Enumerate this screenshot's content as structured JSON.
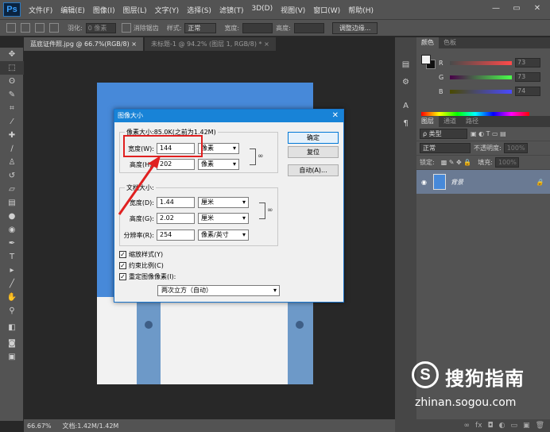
{
  "app": {
    "logo": "Ps"
  },
  "menu": [
    "文件(F)",
    "编辑(E)",
    "图像(I)",
    "图层(L)",
    "文字(Y)",
    "选择(S)",
    "滤镜(T)",
    "3D(D)",
    "视图(V)",
    "窗口(W)",
    "帮助(H)"
  ],
  "window_controls": [
    "—",
    "▭",
    "✕"
  ],
  "options_bar": {
    "feather_label": "羽化:",
    "feather_value": "0 像素",
    "antialias_label": "消除锯齿",
    "style_label": "样式:",
    "style_value": "正常",
    "width_label": "宽度:",
    "height_label": "高度:",
    "refine_edge": "调整边缘..."
  },
  "doc_tabs": [
    {
      "label": "蓝底证件照.jpg @ 66.7%(RGB/8)",
      "close": "×"
    },
    {
      "label": "未标题-1 @ 94.2% (图层 1, RGB/8) *",
      "close": "×"
    }
  ],
  "status": {
    "zoom": "66.67%",
    "doc": "文档:1.42M/1.42M"
  },
  "color_panel": {
    "tabs": [
      "颜色",
      "色板"
    ],
    "rows": [
      {
        "label": "R",
        "value": "73"
      },
      {
        "label": "G",
        "value": "73"
      },
      {
        "label": "B",
        "value": "74"
      }
    ]
  },
  "layers_panel": {
    "tabs": [
      "图层",
      "通道",
      "路径"
    ],
    "kind_label": "ρ 类型",
    "blend_mode": "正常",
    "opacity_label": "不透明度:",
    "opacity_value": "100%",
    "lock_label": "锁定:",
    "fill_label": "填充:",
    "fill_value": "100%",
    "layer_name": "背景",
    "footer_icons": [
      "∞",
      "fx",
      "◘",
      "◐",
      "▭",
      "▣",
      "🗑"
    ]
  },
  "dialog": {
    "title": "图像大小",
    "close": "✕",
    "pixel_dims": "像素大小:85.0K(之前为1.42M)",
    "width_label": "宽度(W):",
    "width_value": "144",
    "width_unit": "像素",
    "height_label": "高度(H):",
    "height_value": "202",
    "height_unit": "像素",
    "doc_size": "文档大小:",
    "doc_width_label": "宽度(D):",
    "doc_width_value": "1.44",
    "doc_width_unit": "厘米",
    "doc_height_label": "高度(G):",
    "doc_height_value": "2.02",
    "doc_height_unit": "厘米",
    "resolution_label": "分辨率(R):",
    "resolution_value": "254",
    "resolution_unit": "像素/英寸",
    "ok": "确定",
    "reset": "复位",
    "auto": "自动(A)...",
    "scale_styles": "缩放样式(Y)",
    "constrain": "约束比例(C)",
    "resample": "重定图像像素(I):",
    "resample_method": "两次立方（自动）"
  },
  "watermark": {
    "logo": "S",
    "name": "搜狗指南",
    "url": "zhinan.sogou.com"
  }
}
